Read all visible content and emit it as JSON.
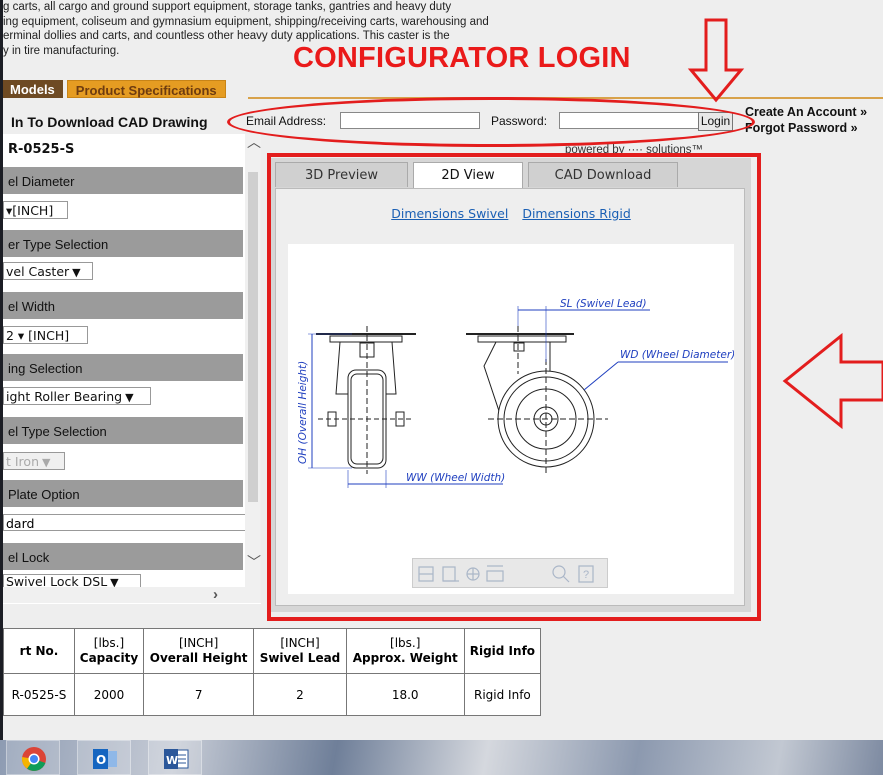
{
  "intro": {
    "lines": [
      "g carts, all cargo and ground support equipment, storage tanks, gantries and heavy duty",
      "ing equipment, coliseum and gymnasium equipment, shipping/receiving carts, warehousing and",
      "erminal dollies and carts, and countless other heavy duty applications. This caster is the",
      "y in tire manufacturing."
    ]
  },
  "tabs": {
    "models": "Models",
    "specs": "Product Specifications"
  },
  "cad_prompt": "In To Download CAD Drawing",
  "login": {
    "email_label": "Email Address:",
    "email_value": "",
    "password_label": "Password:",
    "password_value": "",
    "button": "Login",
    "create_account": "Create An Account »",
    "forgot_password": "Forgot Password »"
  },
  "annotation": {
    "title": "CONFIGURATOR LOGIN"
  },
  "config": {
    "part_number": "R-0525-S",
    "sections": [
      {
        "label": "el Diameter",
        "value": "[INCH]"
      },
      {
        "label": "er Type Selection",
        "value": "vel Caster"
      },
      {
        "label": "el Width",
        "value": "2 ▾ [INCH]"
      },
      {
        "label": "ing Selection",
        "value": "ight Roller Bearing"
      },
      {
        "label": "el Type Selection",
        "value": "t Iron"
      },
      {
        "label": "Plate Option",
        "value": "dard"
      },
      {
        "label": "el Lock",
        "value": "Swivel Lock DSL"
      }
    ]
  },
  "viewer": {
    "powered_by": "powered by ···· solutions™",
    "tabs": [
      "3D Preview",
      "2D View",
      "CAD Download"
    ],
    "active_tab": "2D View",
    "links": {
      "swivel": "Dimensions Swivel",
      "rigid": "Dimensions Rigid"
    },
    "drawing_labels": {
      "sl": "SL (Swivel Lead)",
      "wd": "WD (Wheel Diameter)",
      "oh": "OH (Overall Height)",
      "ww": "WW (Wheel Width)"
    }
  },
  "table": {
    "headers": [
      {
        "unit": "",
        "label": "rt No."
      },
      {
        "unit": "[lbs.]",
        "label": "Capacity"
      },
      {
        "unit": "[INCH]",
        "label": "Overall Height"
      },
      {
        "unit": "[INCH]",
        "label": "Swivel Lead"
      },
      {
        "unit": "[lbs.]",
        "label": "Approx. Weight"
      },
      {
        "unit": "",
        "label": "Rigid Info"
      }
    ],
    "rows": [
      [
        "R-0525-S",
        "2000",
        "7",
        "2",
        "18.0",
        "Rigid Info"
      ]
    ]
  },
  "colors": {
    "annotation_red": "#e31d1d",
    "tab_brown": "#6e4a23",
    "tab_gold": "#e59c22",
    "link_blue": "#1a5fb4"
  },
  "taskbar": {
    "apps": [
      "chrome-icon",
      "outlook-icon",
      "word-icon"
    ]
  }
}
